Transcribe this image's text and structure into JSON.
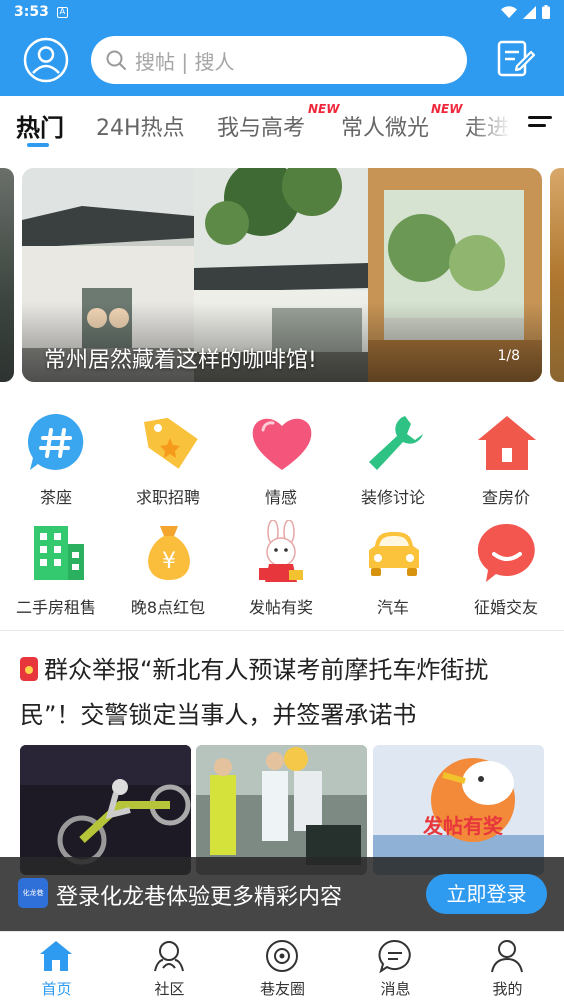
{
  "status_bar": {
    "time": "3:53",
    "notif_glyph": "A"
  },
  "header": {
    "search_placeholder": "搜帖 | 搜人",
    "avatar_icon": "user-avatar-icon",
    "post_icon": "edit-post-icon",
    "accent": "#2f9bf0"
  },
  "tabs": [
    {
      "label": "热门",
      "active": true
    },
    {
      "label": "24H热点",
      "active": false
    },
    {
      "label": "我与高考",
      "badge": "NEW"
    },
    {
      "label": "常人微光",
      "badge": "NEW"
    },
    {
      "label": "走进",
      "active": false
    }
  ],
  "banner": {
    "caption": "常州居然藏着这样的咖啡馆!",
    "counter": "1/8"
  },
  "categories": [
    {
      "label": "茶座",
      "icon": "hash-chat-icon"
    },
    {
      "label": "求职招聘",
      "icon": "tag-icon"
    },
    {
      "label": "情感",
      "icon": "heart-icon"
    },
    {
      "label": "装修讨论",
      "icon": "wrench-icon"
    },
    {
      "label": "查房价",
      "icon": "house-icon"
    },
    {
      "label": "二手房租售",
      "icon": "building-icon"
    },
    {
      "label": "晚8点红包",
      "icon": "money-bag-icon"
    },
    {
      "label": "发帖有奖",
      "icon": "rabbit-mascot-icon"
    },
    {
      "label": "汽车",
      "icon": "car-icon"
    },
    {
      "label": "征婚交友",
      "icon": "chat-bubble-icon"
    }
  ],
  "article": {
    "title": "群众举报“新北有人预谋考前摩托车炸街扰民”！交警锁定当事人，并签署承诺书",
    "thumb3_text": "发帖有奖"
  },
  "login_banner": {
    "logo_text": "化龙巷",
    "text": "登录化龙巷体验更多精彩内容",
    "button": "立即登录"
  },
  "bottom_nav": [
    {
      "label": "首页",
      "icon": "home-icon",
      "active": true
    },
    {
      "label": "社区",
      "icon": "community-icon"
    },
    {
      "label": "巷友圈",
      "icon": "planet-icon"
    },
    {
      "label": "消息",
      "icon": "message-icon"
    },
    {
      "label": "我的",
      "icon": "profile-icon"
    }
  ]
}
